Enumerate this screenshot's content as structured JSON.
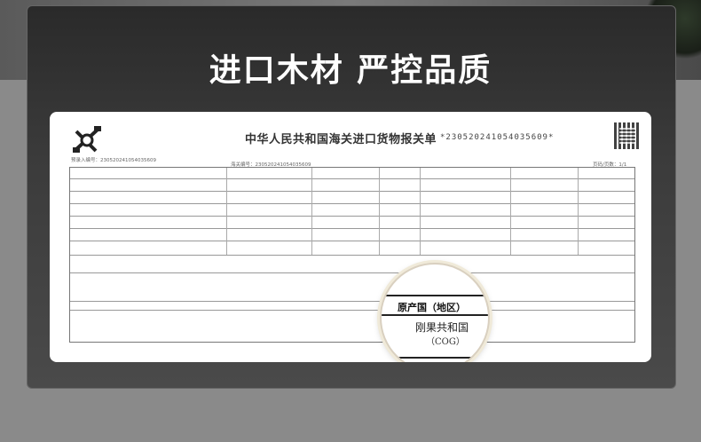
{
  "heading": "进口木材 严控品质",
  "document": {
    "title": "中华人民共和国海关进口货物报关单",
    "barcode_number": "*230520241054035609*",
    "meta_left": "预录入编号：230520241054035609",
    "meta_mid": "海关编号：230520241054035609",
    "meta_right": "页码/页数：1/1"
  },
  "magnifier": {
    "field_label": "原产国（地区）",
    "country": "刚果共和国",
    "country_code": "（COG）"
  }
}
